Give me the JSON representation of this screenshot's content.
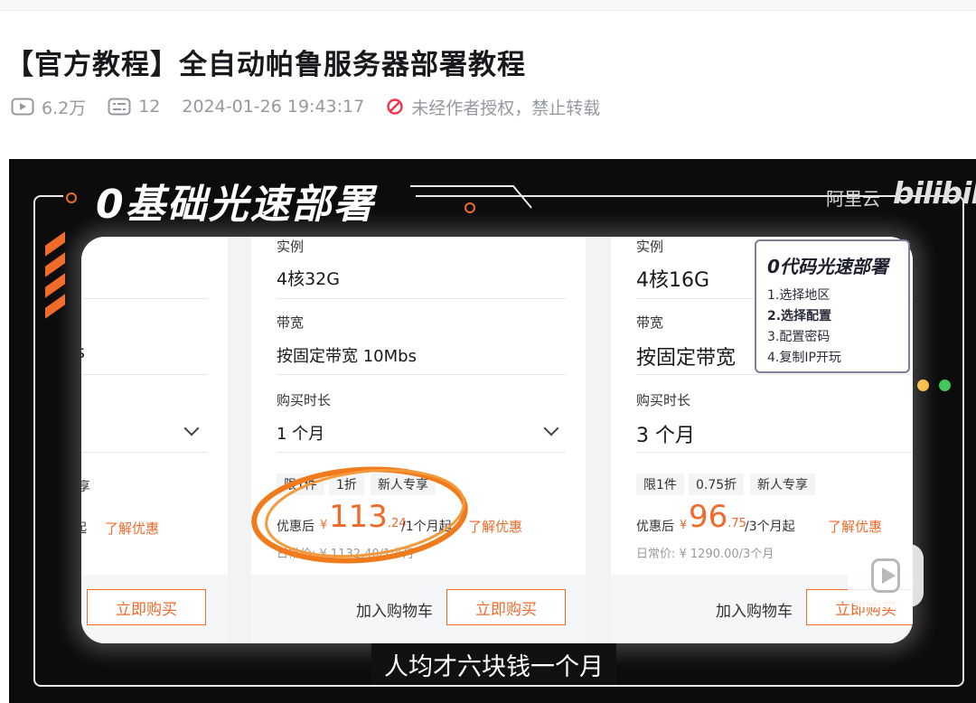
{
  "page": {
    "title": "【官方教程】全自动帕鲁服务器部署教程",
    "meta": {
      "views": "6.2万",
      "danmaku": "12",
      "datetime": "2024-01-26 19:43:17",
      "copyright": "未经作者授权，禁止转载"
    }
  },
  "video": {
    "header": "0基础光速部署",
    "brand": "阿里云",
    "logo": "bilibili",
    "subtitle": "人均才六块钱一个月",
    "steps": {
      "title": "0代码光速部署",
      "items": [
        "1.选择地区",
        "2.选择配置",
        "3.配置密码",
        "4.复制IP开玩"
      ]
    },
    "accent": "#f06a2a",
    "cards": [
      {
        "bandwidth_partial": "s",
        "tag_partial": "享",
        "ellipsis": "起",
        "learn": "了解优惠",
        "buy": "立即购买"
      },
      {
        "instance_label": "实例",
        "instance": "4核32G",
        "bandwidth_label": "带宽",
        "bandwidth": "按固定带宽 10Mbs",
        "duration_label": "购买时长",
        "duration": "1 个月",
        "tags": [
          "限1件",
          "1折",
          "新人专享"
        ],
        "promo_label": "优惠后",
        "currency": "¥",
        "price_int": "113",
        "price_dec": ".24",
        "price_unit": "/1个月起",
        "learn": "了解优惠",
        "orig": "日常价: ¥ 1132.40/1个月",
        "cart": "加入购物车",
        "buy": "立即购买"
      },
      {
        "instance_label": "实例",
        "instance": "4核16G",
        "bandwidth_label": "带宽",
        "bandwidth": "按固定带宽",
        "duration_label": "购买时长",
        "duration": "3 个月",
        "tags": [
          "限1件",
          "0.75折",
          "新人专享"
        ],
        "promo_label": "优惠后",
        "currency": "¥",
        "price_int": "96",
        "price_dec": ".75",
        "price_unit": "/3个月起",
        "learn": "了解优惠",
        "orig": "日常价: ¥ 1290.00/3个月",
        "cart": "加入购物车",
        "buy": "立即购买"
      }
    ]
  }
}
